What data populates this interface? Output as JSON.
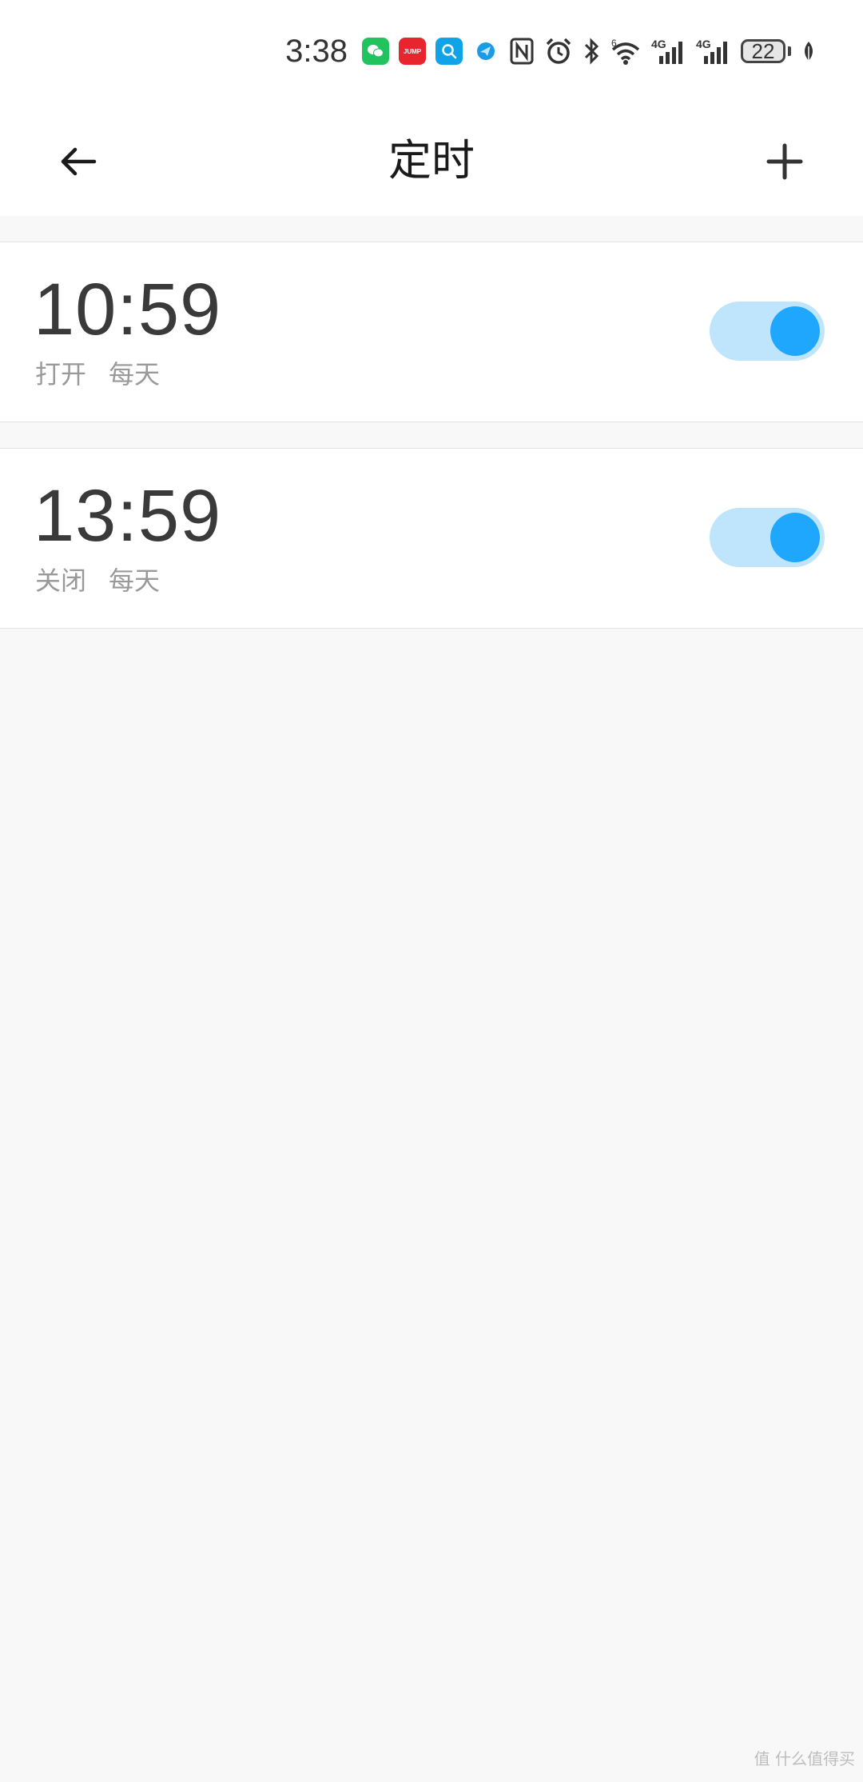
{
  "status_bar": {
    "time": "3:38",
    "battery": "22",
    "icons": [
      "wechat-icon",
      "jump-app-icon",
      "search-app-icon",
      "blue-app-icon",
      "nfc-icon",
      "alarm-icon",
      "bluetooth-icon",
      "wifi-icon",
      "signal-4g-icon",
      "signal-4g-icon",
      "battery-icon",
      "leaf-icon"
    ],
    "jump_label": "JUMP",
    "network_labels": [
      "4G",
      "4G"
    ],
    "wifi_label": "6"
  },
  "header": {
    "title": "定时"
  },
  "timers": [
    {
      "time": "10:59",
      "action": "打开",
      "repeat": "每天",
      "enabled": true
    },
    {
      "time": "13:59",
      "action": "关闭",
      "repeat": "每天",
      "enabled": true
    }
  ],
  "colors": {
    "accent": "#1ea7fd",
    "toggle_track": "#bfe5fc",
    "background": "#f8f8f8"
  },
  "watermark": "值 什么值得买"
}
